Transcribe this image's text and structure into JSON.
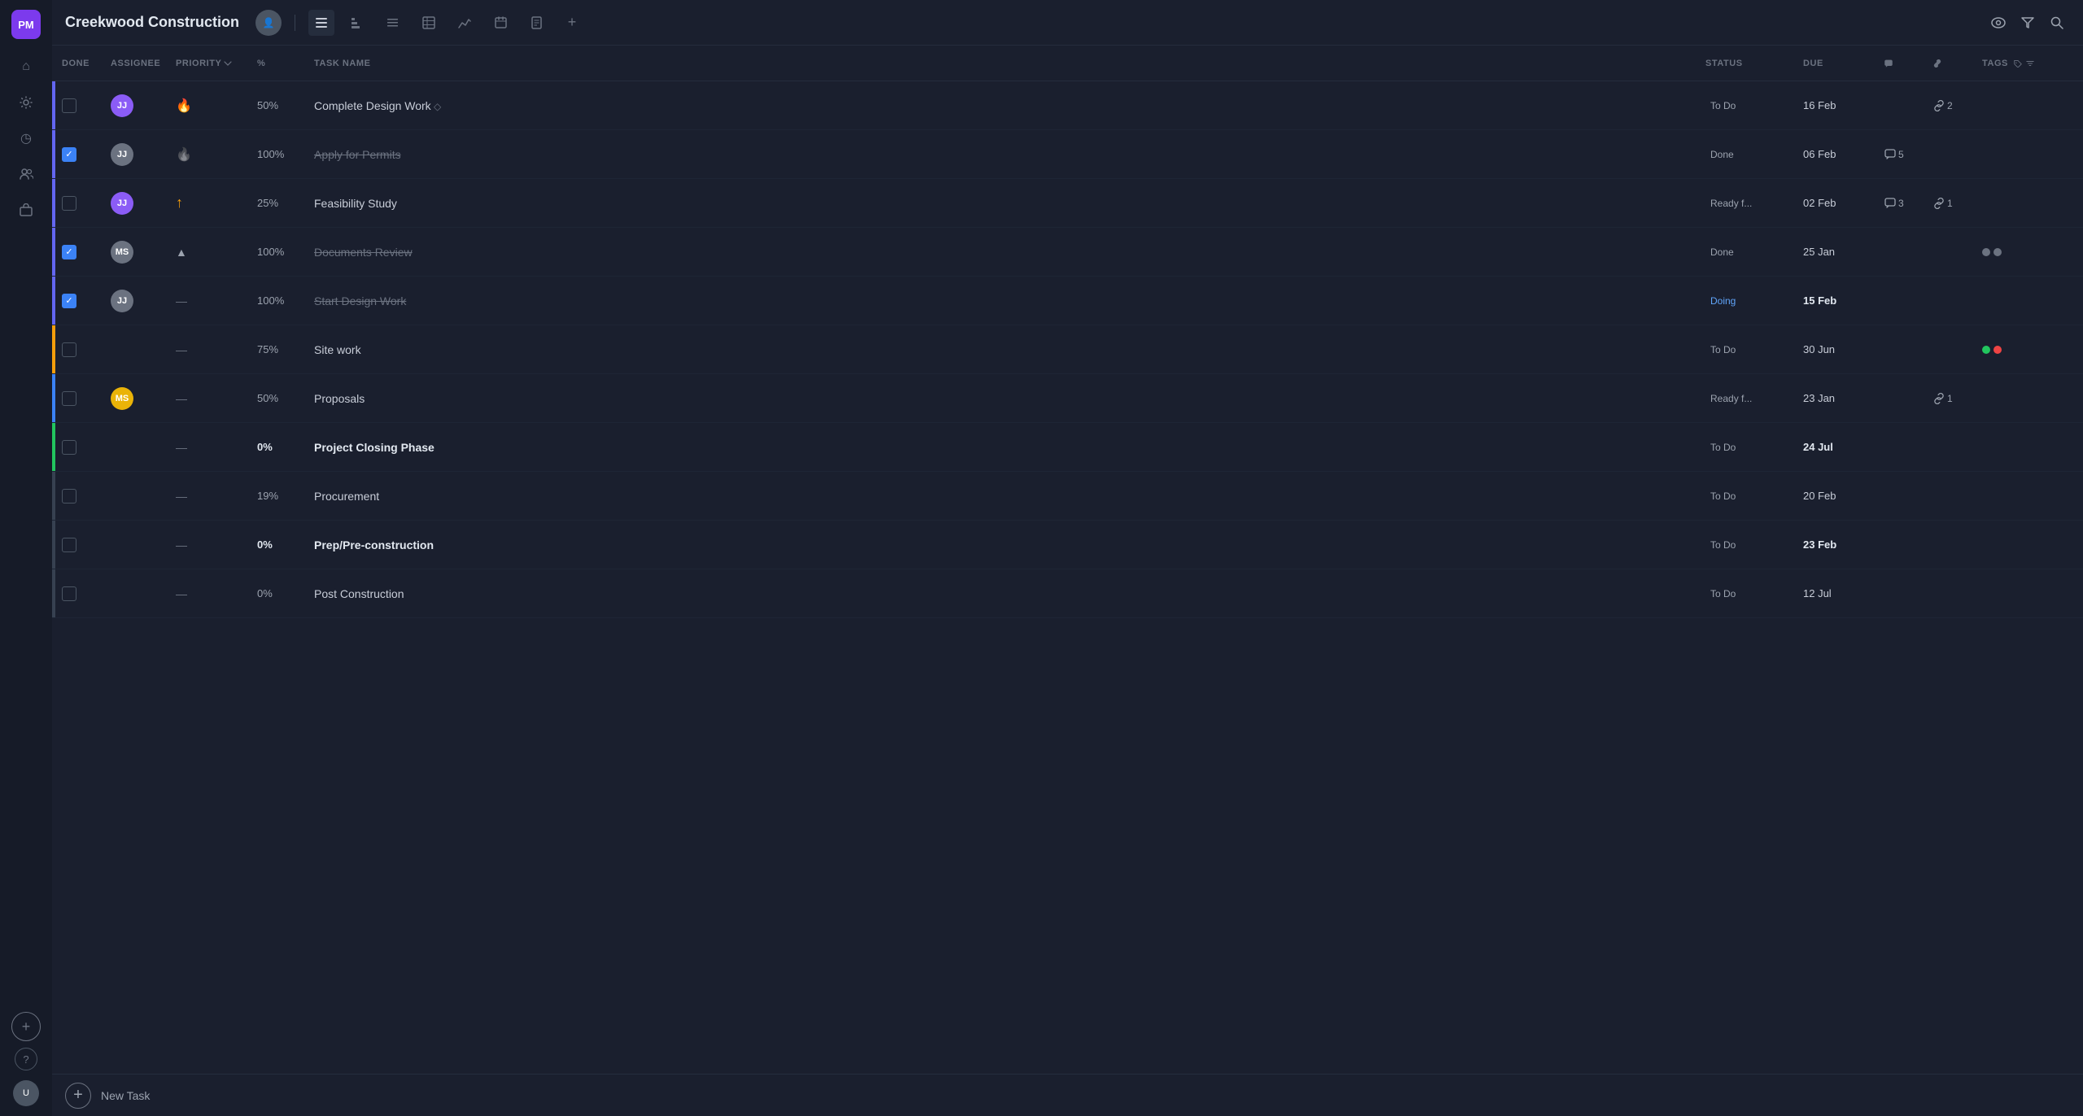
{
  "app": {
    "title": "Creekwood Construction",
    "logo": "PM"
  },
  "sidebar": {
    "icons": [
      {
        "name": "home-icon",
        "symbol": "⌂"
      },
      {
        "name": "bell-icon",
        "symbol": "🔔"
      },
      {
        "name": "clock-icon",
        "symbol": "◷"
      },
      {
        "name": "people-icon",
        "symbol": "👥"
      },
      {
        "name": "briefcase-icon",
        "symbol": "💼"
      }
    ],
    "bottom_icons": [
      {
        "name": "add-workspace-icon",
        "symbol": "+"
      },
      {
        "name": "help-icon",
        "symbol": "?"
      }
    ]
  },
  "toolbar": {
    "views": [
      {
        "name": "list-view",
        "symbol": "☰",
        "active": true
      },
      {
        "name": "gantt-view",
        "symbol": "▦",
        "active": false
      },
      {
        "name": "board-view",
        "symbol": "≡",
        "active": false
      },
      {
        "name": "table-view",
        "symbol": "▤",
        "active": false
      },
      {
        "name": "chart-view",
        "symbol": "⌇",
        "active": false
      },
      {
        "name": "calendar-view",
        "symbol": "▦",
        "active": false
      },
      {
        "name": "doc-view",
        "symbol": "▢",
        "active": false
      },
      {
        "name": "add-view",
        "symbol": "+",
        "active": false
      }
    ],
    "right_icons": [
      {
        "name": "watch-icon",
        "symbol": "👁"
      },
      {
        "name": "filter-icon",
        "symbol": "⧗"
      },
      {
        "name": "search-icon",
        "symbol": "⌕"
      }
    ]
  },
  "table": {
    "columns": [
      {
        "key": "done",
        "label": "DONE"
      },
      {
        "key": "assignee",
        "label": "ASSIGNEE"
      },
      {
        "key": "priority",
        "label": "PRIORITY"
      },
      {
        "key": "pct",
        "label": "%"
      },
      {
        "key": "task_name",
        "label": "TASK NAME"
      },
      {
        "key": "status",
        "label": "STATUS"
      },
      {
        "key": "due",
        "label": "DUE"
      },
      {
        "key": "comments",
        "label": ""
      },
      {
        "key": "links",
        "label": ""
      },
      {
        "key": "tags",
        "label": "TAGS"
      }
    ],
    "rows": [
      {
        "id": "row-1",
        "checked": false,
        "bar_color": "#6366f1",
        "assignee_initials": "JJ",
        "assignee_color": "#8b5cf6",
        "priority": "fire",
        "priority_symbol": "🔥",
        "pct": "50%",
        "pct_bold": false,
        "task_name": "Complete Design Work",
        "task_style": "diamond",
        "status": "To Do",
        "status_class": "status-todo",
        "due": "16 Feb",
        "due_class": "due",
        "comments": "",
        "comments_count": "",
        "links_count": "2",
        "tags": []
      },
      {
        "id": "row-2",
        "checked": true,
        "bar_color": "#6366f1",
        "assignee_initials": "JJ",
        "assignee_color": "#6b7280",
        "priority": "fire-gray",
        "priority_symbol": "🔥",
        "pct": "100%",
        "pct_bold": false,
        "task_name": "Apply for Permits",
        "task_style": "strikethrough",
        "status": "Done",
        "status_class": "status-done",
        "due": "06 Feb",
        "due_class": "due",
        "comments_count": "5",
        "links_count": "",
        "tags": []
      },
      {
        "id": "row-3",
        "checked": false,
        "bar_color": "#6366f1",
        "assignee_initials": "JJ",
        "assignee_color": "#8b5cf6",
        "priority": "up",
        "priority_symbol": "↑",
        "pct": "25%",
        "pct_bold": false,
        "task_name": "Feasibility Study",
        "task_style": "normal",
        "status": "Ready f...",
        "status_class": "status-ready",
        "due": "02 Feb",
        "due_class": "due",
        "comments_count": "3",
        "links_count": "1",
        "tags": []
      },
      {
        "id": "row-4",
        "checked": true,
        "bar_color": "#6366f1",
        "assignee_initials": "MS",
        "assignee_color": "#6b7280",
        "priority": "gray-up",
        "priority_symbol": "▲",
        "pct": "100%",
        "pct_bold": false,
        "task_name": "Documents Review",
        "task_style": "strikethrough",
        "status": "Done",
        "status_class": "status-done",
        "due": "25 Jan",
        "due_class": "due",
        "comments_count": "",
        "links_count": "",
        "tags": [
          {
            "color": "#6b7280"
          },
          {
            "color": "#6b7280"
          }
        ]
      },
      {
        "id": "row-5",
        "checked": true,
        "bar_color": "#6366f1",
        "assignee_initials": "JJ",
        "assignee_color": "#6b7280",
        "priority": "dash",
        "priority_symbol": "—",
        "pct": "100%",
        "pct_bold": false,
        "task_name": "Start Design Work",
        "task_style": "strikethrough",
        "status": "Doing",
        "status_class": "status-doing",
        "due": "15 Feb",
        "due_class": "due bold",
        "comments_count": "",
        "links_count": "",
        "tags": []
      },
      {
        "id": "row-6",
        "checked": false,
        "bar_color": "#f59e0b",
        "assignee_initials": "",
        "assignee_color": "",
        "priority": "dash",
        "priority_symbol": "—",
        "pct": "75%",
        "pct_bold": false,
        "task_name": "Site work",
        "task_style": "normal",
        "status": "To Do",
        "status_class": "status-todo",
        "due": "30 Jun",
        "due_class": "due",
        "comments_count": "",
        "links_count": "",
        "tags": [
          {
            "color": "#22c55e"
          },
          {
            "color": "#ef4444"
          }
        ]
      },
      {
        "id": "row-7",
        "checked": false,
        "bar_color": "#3b82f6",
        "assignee_initials": "MS",
        "assignee_color": "#eab308",
        "priority": "dash",
        "priority_symbol": "—",
        "pct": "50%",
        "pct_bold": false,
        "task_name": "Proposals",
        "task_style": "normal",
        "status": "Ready f...",
        "status_class": "status-ready",
        "due": "23 Jan",
        "due_class": "due",
        "comments_count": "",
        "links_count": "1",
        "tags": []
      },
      {
        "id": "row-8",
        "checked": false,
        "bar_color": "#22c55e",
        "assignee_initials": "",
        "assignee_color": "",
        "priority": "dash",
        "priority_symbol": "—",
        "pct": "0%",
        "pct_bold": true,
        "task_name": "Project Closing Phase",
        "task_style": "bold",
        "status": "To Do",
        "status_class": "status-todo",
        "due": "24 Jul",
        "due_class": "due bold",
        "comments_count": "",
        "links_count": "",
        "tags": []
      },
      {
        "id": "row-9",
        "checked": false,
        "bar_color": "#374151",
        "assignee_initials": "",
        "assignee_color": "",
        "priority": "dash",
        "priority_symbol": "—",
        "pct": "19%",
        "pct_bold": false,
        "task_name": "Procurement",
        "task_style": "normal",
        "status": "To Do",
        "status_class": "status-todo",
        "due": "20 Feb",
        "due_class": "due",
        "comments_count": "",
        "links_count": "",
        "tags": []
      },
      {
        "id": "row-10",
        "checked": false,
        "bar_color": "#374151",
        "assignee_initials": "",
        "assignee_color": "",
        "priority": "dash",
        "priority_symbol": "—",
        "pct": "0%",
        "pct_bold": true,
        "task_name": "Prep/Pre-construction",
        "task_style": "bold",
        "status": "To Do",
        "status_class": "status-todo",
        "due": "23 Feb",
        "due_class": "due bold",
        "comments_count": "",
        "links_count": "",
        "tags": []
      },
      {
        "id": "row-11",
        "checked": false,
        "bar_color": "#374151",
        "assignee_initials": "",
        "assignee_color": "",
        "priority": "dash",
        "priority_symbol": "—",
        "pct": "0%",
        "pct_bold": false,
        "task_name": "Post Construction",
        "task_style": "normal",
        "status": "To Do",
        "status_class": "status-todo",
        "due": "12 Jul",
        "due_class": "due",
        "comments_count": "",
        "links_count": "",
        "tags": []
      }
    ]
  },
  "bottom": {
    "add_button": "+",
    "new_task_label": "New Task"
  }
}
